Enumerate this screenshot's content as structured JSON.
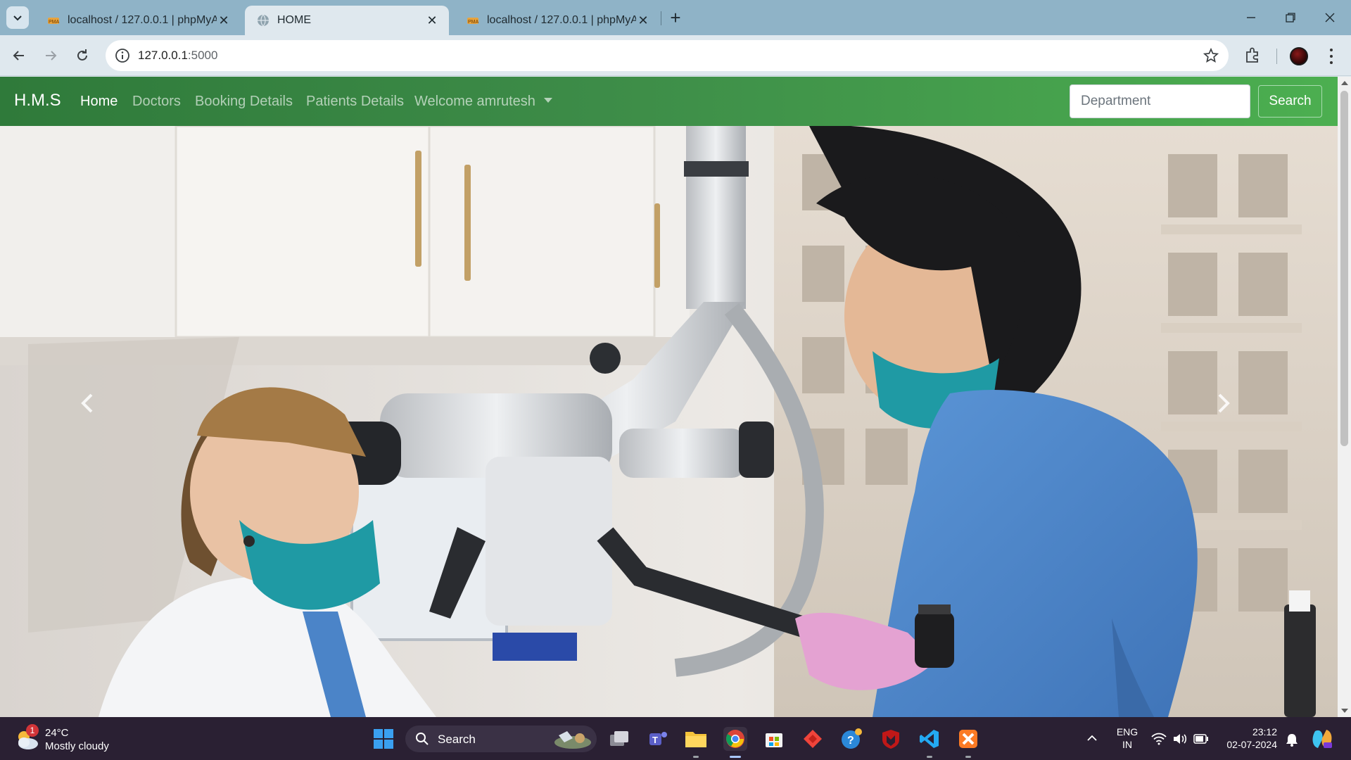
{
  "browser": {
    "tabs": [
      {
        "title": "localhost / 127.0.0.1 | phpMyAdmin",
        "icon": "phpmyadmin-icon",
        "active": false
      },
      {
        "title": "HOME",
        "icon": "globe-icon",
        "active": true
      },
      {
        "title": "localhost / 127.0.0.1 | phpMyAdmin",
        "icon": "phpmyadmin-icon",
        "active": false
      }
    ],
    "url_host": "127.0.0.1",
    "url_port": ":5000"
  },
  "navbar": {
    "brand": "H.M.S",
    "links": [
      {
        "label": "Home",
        "active": true
      },
      {
        "label": "Doctors",
        "active": false
      },
      {
        "label": "Booking Details",
        "active": false
      },
      {
        "label": "Patients Details",
        "active": false
      }
    ],
    "user_dropdown": "Welcome amrutesh",
    "search_placeholder": "Department",
    "search_button": "Search",
    "colors": {
      "start": "#2f7a3a",
      "end": "#4caf50"
    }
  },
  "hero": {
    "description_icon": "dental-microscope-photo",
    "prev_icon": "chevron-left-icon",
    "next_icon": "chevron-right-icon"
  },
  "taskbar": {
    "weather": {
      "temp": "24°C",
      "condition": "Mostly cloudy",
      "badge": "1"
    },
    "search_label": "Search",
    "lang": [
      "ENG",
      "IN"
    ],
    "time": "23:12",
    "date": "02-07-2024"
  }
}
